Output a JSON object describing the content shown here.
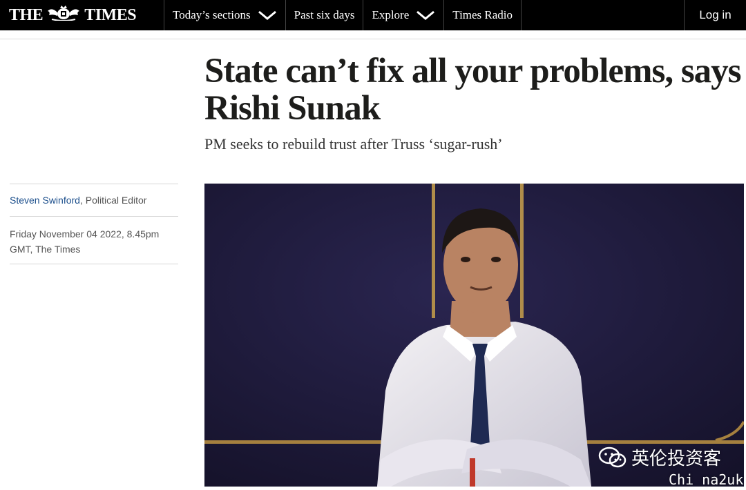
{
  "header": {
    "logo_left": "THE",
    "logo_right": "TIMES",
    "nav": [
      {
        "label": "Today’s sections",
        "has_dropdown": true
      },
      {
        "label": "Past six days",
        "has_dropdown": false
      },
      {
        "label": "Explore",
        "has_dropdown": true
      },
      {
        "label": "Times Radio",
        "has_dropdown": false
      }
    ],
    "login_label": "Log in"
  },
  "article": {
    "headline": "State can’t fix all your problems, says Rishi Sunak",
    "standfirst": "PM seeks to rebuild trust after Truss ‘sugar-rush’",
    "author_name": "Steven Swinford",
    "author_role": ", Political Editor",
    "dateline": "Friday November 04 2022, 8.45pm GMT, The Times"
  },
  "watermark": {
    "line1": "英伦投资客",
    "line2": "Chi na2uk"
  },
  "colors": {
    "nav_bg": "#000000",
    "author_link": "#1c4f8c",
    "photo_bg": "#1d1a36"
  },
  "icons": {
    "crest": "royal-crest-icon",
    "dropdown": "chevron-down-icon",
    "watermark": "wechat-icon"
  }
}
